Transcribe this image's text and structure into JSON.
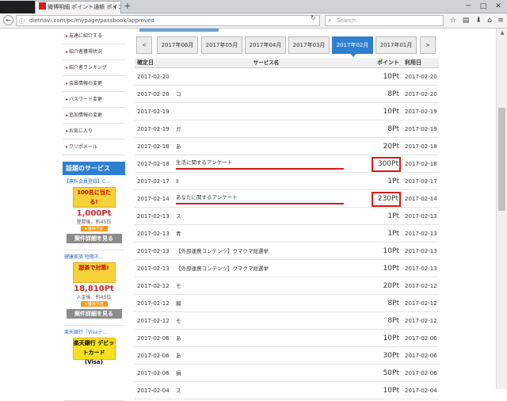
{
  "browser": {
    "tab_dark_label": "",
    "tab_title": "微博明細 ポイント通帳 ポイントサ...",
    "tab_close": "×",
    "newtab": "+",
    "url": "dietnavi.com/pc/mypage/passbook/approved",
    "search_placeholder": "Search",
    "win_min": "─",
    "win_max": "□",
    "win_close": "✕",
    "back": "←",
    "reload": "↻"
  },
  "sidebar": {
    "items": [
      {
        "label": "友達に紹介する"
      },
      {
        "label": "紹介者獲得状況"
      },
      {
        "label": "紹介者ランキング"
      },
      {
        "label": "会員情報の変更"
      },
      {
        "label": "パスワード変更"
      },
      {
        "label": "追加情報の変更"
      },
      {
        "label": "お気に入り"
      },
      {
        "label": "クリポメール"
      }
    ],
    "arrow": "▸",
    "services_heading": "話題のサービス",
    "ads": [
      {
        "title": "【無料会員登録】C...",
        "banner": "100名に当たる!",
        "points": "1,000Pt",
        "sub": "登録後、約45日",
        "badge": "★獲得予定",
        "button": "案件詳細を見る"
      },
      {
        "title": "健康家族 短期ネ...",
        "banner": "甜茶で対策!",
        "points": "18,810Pt",
        "sub": "入金後、約45日",
        "badge": "★獲得予定",
        "button": "案件詳細を見る"
      },
      {
        "title": "楽天銀行「Visaデ...",
        "banner": "楽天銀行 デビットカード (Visa)",
        "points": "",
        "sub": "",
        "badge": "",
        "button": ""
      }
    ]
  },
  "months": {
    "prev": "<",
    "next": ">",
    "items": [
      "2017年06月",
      "2017年05月",
      "2017年04月",
      "2017年03月",
      "2017年02月",
      "2017年01月"
    ],
    "active_index": 4
  },
  "table": {
    "headers": [
      "確定日",
      "サービス名",
      "ポイント",
      "利用日"
    ],
    "rows": [
      {
        "confirm": "2017-02-20",
        "service": "",
        "points": "10Pt",
        "used": "2017-02-20"
      },
      {
        "confirm": "2017-02-20",
        "service": "コ",
        "points": "8Pt",
        "used": "2017-02-20"
      },
      {
        "confirm": "2017-02-19",
        "service": "",
        "points": "10Pt",
        "used": "2017-02-19"
      },
      {
        "confirm": "2017-02-19",
        "service": "ガ",
        "points": "8Pt",
        "used": "2017-02-19"
      },
      {
        "confirm": "2017-02-18",
        "service": "あ",
        "points": "20Pt",
        "used": "2017-02-18"
      },
      {
        "confirm": "2017-02-18",
        "service": "生活に関するアンケート",
        "points": "300Pt",
        "used": "2017-02-18",
        "highlight": true
      },
      {
        "confirm": "2017-02-17",
        "service": "ll",
        "points": "1Pt",
        "used": "2017-02-17"
      },
      {
        "confirm": "2017-02-14",
        "service": "あなたに関するアンケート",
        "points": "230Pt",
        "used": "2017-02-14",
        "highlight": true
      },
      {
        "confirm": "2017-02-13",
        "service": "ス",
        "points": "1Pt",
        "used": "2017-02-13"
      },
      {
        "confirm": "2017-02-13",
        "service": "青",
        "points": "1Pt",
        "used": "2017-02-13"
      },
      {
        "confirm": "2017-02-13",
        "service": "【外部連携コンテンツ】クマクマ総選挙",
        "points": "10Pt",
        "used": "2017-02-13"
      },
      {
        "confirm": "2017-02-13",
        "service": "【外部連携コンテンツ】クマクマ総選挙",
        "points": "10Pt",
        "used": "2017-02-13"
      },
      {
        "confirm": "2017-02-12",
        "service": "モ",
        "points": "20Pt",
        "used": "2017-02-12"
      },
      {
        "confirm": "2017-02-12",
        "service": "編",
        "points": "8Pt",
        "used": "2017-02-12"
      },
      {
        "confirm": "2017-02-12",
        "service": "モ",
        "points": "8Pt",
        "used": "2017-02-12"
      },
      {
        "confirm": "2017-02-06",
        "service": "あ",
        "points": "10Pt",
        "used": "2017-02-06"
      },
      {
        "confirm": "2017-02-06",
        "service": "あ",
        "points": "30Pt",
        "used": "2017-02-06"
      },
      {
        "confirm": "2017-02-06",
        "service": "損",
        "points": "50Pt",
        "used": "2017-02-06"
      },
      {
        "confirm": "2017-02-04",
        "service": "ス",
        "points": "10Pt",
        "used": "2017-02-04"
      }
    ]
  },
  "colors": {
    "accent": "#2f7fd0",
    "highlight": "#e01818"
  }
}
